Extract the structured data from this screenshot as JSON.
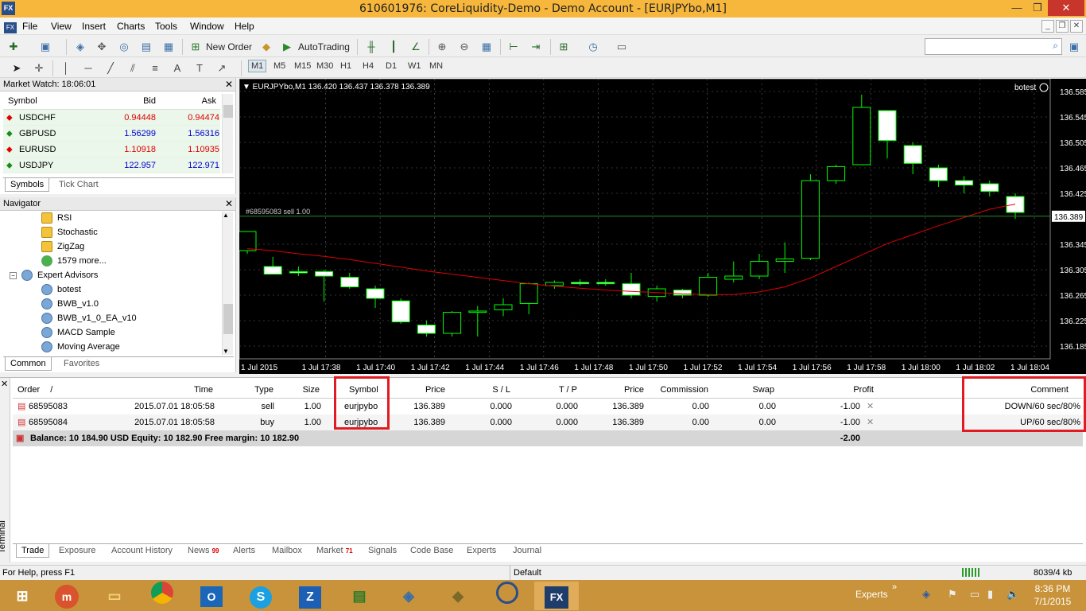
{
  "window": {
    "title": "610601976: CoreLiquidity-Demo - Demo Account - [EURJPYbo,M1]",
    "app_icon": "FX",
    "minimize": "—",
    "maximize": "❐",
    "close": "✕"
  },
  "menu": {
    "items": [
      "File",
      "View",
      "Insert",
      "Charts",
      "Tools",
      "Window",
      "Help"
    ]
  },
  "toolbar": {
    "new_order": "New Order",
    "autotrading": "AutoTrading",
    "timeframes": [
      "M1",
      "M5",
      "M15",
      "M30",
      "H1",
      "H4",
      "D1",
      "W1",
      "MN"
    ],
    "active_timeframe": "M1"
  },
  "market_watch": {
    "title": "Market Watch: 18:06:01",
    "columns": [
      "Symbol",
      "Bid",
      "Ask"
    ],
    "rows": [
      {
        "symbol": "USDCHF",
        "bid": "0.94448",
        "ask": "0.94474",
        "dir": "down"
      },
      {
        "symbol": "GBPUSD",
        "bid": "1.56299",
        "ask": "1.56316",
        "dir": "up"
      },
      {
        "symbol": "EURUSD",
        "bid": "1.10918",
        "ask": "1.10935",
        "dir": "down"
      },
      {
        "symbol": "USDJPY",
        "bid": "122.957",
        "ask": "122.971",
        "dir": "up"
      }
    ],
    "tabs": [
      "Symbols",
      "Tick Chart"
    ]
  },
  "navigator": {
    "title": "Navigator",
    "items": [
      {
        "label": "RSI",
        "kind": "indicator"
      },
      {
        "label": "Stochastic",
        "kind": "indicator"
      },
      {
        "label": "ZigZag",
        "kind": "indicator"
      },
      {
        "label": "1579 more...",
        "kind": "more"
      },
      {
        "label": "Expert Advisors",
        "kind": "folder"
      },
      {
        "label": "botest",
        "kind": "ea"
      },
      {
        "label": "BWB_v1.0",
        "kind": "ea"
      },
      {
        "label": "BWB_v1_0_EA_v10",
        "kind": "ea"
      },
      {
        "label": "MACD Sample",
        "kind": "ea"
      },
      {
        "label": "Moving Average",
        "kind": "ea"
      }
    ],
    "tabs": [
      "Common",
      "Favorites"
    ]
  },
  "chart": {
    "header": "EURJPYbo,M1  136.420 136.437 136.378 136.389",
    "ea_label": "botest",
    "order_label": "#68595083 sell 1.00",
    "current_price": "136.389",
    "y_ticks": [
      "136.585",
      "136.545",
      "136.505",
      "136.465",
      "136.425",
      "136.345",
      "136.305",
      "136.265",
      "136.225",
      "136.185"
    ],
    "x_ticks": [
      "1 Jul 2015",
      "1 Jul 17:38",
      "1 Jul 17:40",
      "1 Jul 17:42",
      "1 Jul 17:44",
      "1 Jul 17:46",
      "1 Jul 17:48",
      "1 Jul 17:50",
      "1 Jul 17:52",
      "1 Jul 17:54",
      "1 Jul 17:56",
      "1 Jul 17:58",
      "1 Jul 18:00",
      "1 Jul 18:02",
      "1 Jul 18:04"
    ],
    "ylim": [
      136.165,
      136.605
    ],
    "candles": [
      {
        "o": 136.335,
        "h": 136.36,
        "l": 136.33,
        "c": 136.365
      },
      {
        "o": 136.31,
        "h": 136.325,
        "l": 136.3,
        "c": 136.298
      },
      {
        "o": 136.302,
        "h": 136.31,
        "l": 136.295,
        "c": 136.3
      },
      {
        "o": 136.302,
        "h": 136.305,
        "l": 136.255,
        "c": 136.295
      },
      {
        "o": 136.293,
        "h": 136.3,
        "l": 136.275,
        "c": 136.278
      },
      {
        "o": 136.275,
        "h": 136.28,
        "l": 136.245,
        "c": 136.26
      },
      {
        "o": 136.256,
        "h": 136.26,
        "l": 136.22,
        "c": 136.223
      },
      {
        "o": 136.218,
        "h": 136.225,
        "l": 136.2,
        "c": 136.205
      },
      {
        "o": 136.205,
        "h": 136.24,
        "l": 136.2,
        "c": 136.238
      },
      {
        "o": 136.238,
        "h": 136.248,
        "l": 136.2,
        "c": 136.24
      },
      {
        "o": 136.242,
        "h": 136.26,
        "l": 136.232,
        "c": 136.25
      },
      {
        "o": 136.252,
        "h": 136.285,
        "l": 136.235,
        "c": 136.283
      },
      {
        "o": 136.28,
        "h": 136.288,
        "l": 136.275,
        "c": 136.285
      },
      {
        "o": 136.285,
        "h": 136.29,
        "l": 136.28,
        "c": 136.283
      },
      {
        "o": 136.285,
        "h": 136.29,
        "l": 136.28,
        "c": 136.283
      },
      {
        "o": 136.283,
        "h": 136.3,
        "l": 136.26,
        "c": 136.265
      },
      {
        "o": 136.263,
        "h": 136.28,
        "l": 136.255,
        "c": 136.275
      },
      {
        "o": 136.273,
        "h": 136.275,
        "l": 136.26,
        "c": 136.265
      },
      {
        "o": 136.265,
        "h": 136.3,
        "l": 136.262,
        "c": 136.293
      },
      {
        "o": 136.29,
        "h": 136.318,
        "l": 136.285,
        "c": 136.295
      },
      {
        "o": 136.295,
        "h": 136.33,
        "l": 136.29,
        "c": 136.318
      },
      {
        "o": 136.318,
        "h": 136.348,
        "l": 136.3,
        "c": 136.322
      },
      {
        "o": 136.323,
        "h": 136.455,
        "l": 136.32,
        "c": 136.445
      },
      {
        "o": 136.445,
        "h": 136.47,
        "l": 136.44,
        "c": 136.467
      },
      {
        "o": 136.47,
        "h": 136.58,
        "l": 136.47,
        "c": 136.56
      },
      {
        "o": 136.555,
        "h": 136.555,
        "l": 136.48,
        "c": 136.508
      },
      {
        "o": 136.5,
        "h": 136.505,
        "l": 136.455,
        "c": 136.472
      },
      {
        "o": 136.465,
        "h": 136.47,
        "l": 136.435,
        "c": 136.445
      },
      {
        "o": 136.445,
        "h": 136.452,
        "l": 136.425,
        "c": 136.438
      },
      {
        "o": 136.44,
        "h": 136.445,
        "l": 136.42,
        "c": 136.428
      },
      {
        "o": 136.42,
        "h": 136.425,
        "l": 136.385,
        "c": 136.395
      }
    ],
    "ma": [
      136.338,
      136.335,
      136.33,
      136.326,
      136.321,
      136.315,
      136.309,
      136.303,
      136.298,
      136.293,
      136.288,
      136.283,
      136.279,
      136.276,
      136.273,
      136.271,
      136.269,
      136.267,
      136.266,
      136.266,
      136.27,
      136.278,
      136.292,
      136.31,
      136.328,
      136.346,
      136.36,
      136.374,
      136.387,
      136.4,
      136.408
    ]
  },
  "terminal": {
    "side_label": "Terminal",
    "columns": [
      "Order",
      "Time",
      "Type",
      "Size",
      "Symbol",
      "Price",
      "S / L",
      "T / P",
      "Price",
      "Commission",
      "Swap",
      "Profit",
      "Comment"
    ],
    "sort_mark": "/",
    "rows": [
      {
        "order": "68595083",
        "time": "2015.07.01 18:05:58",
        "type": "sell",
        "size": "1.00",
        "symbol": "eurjpybo",
        "price": "136.389",
        "sl": "0.000",
        "tp": "0.000",
        "cur": "136.389",
        "commission": "0.00",
        "swap": "0.00",
        "profit": "-1.00",
        "comment": "DOWN/60 sec/80%"
      },
      {
        "order": "68595084",
        "time": "2015.07.01 18:05:58",
        "type": "buy",
        "size": "1.00",
        "symbol": "eurjpybo",
        "price": "136.389",
        "sl": "0.000",
        "tp": "0.000",
        "cur": "136.389",
        "commission": "0.00",
        "swap": "0.00",
        "profit": "-1.00",
        "comment": "UP/60 sec/80%"
      }
    ],
    "balance_line": "Balance: 10 184.90 USD  Equity: 10 182.90  Free margin: 10 182.90",
    "total_profit": "-2.00",
    "tabs": [
      {
        "label": "Trade",
        "badge": ""
      },
      {
        "label": "Exposure",
        "badge": ""
      },
      {
        "label": "Account History",
        "badge": ""
      },
      {
        "label": "News",
        "badge": "99"
      },
      {
        "label": "Alerts",
        "badge": ""
      },
      {
        "label": "Mailbox",
        "badge": ""
      },
      {
        "label": "Market",
        "badge": "71"
      },
      {
        "label": "Signals",
        "badge": ""
      },
      {
        "label": "Code Base",
        "badge": ""
      },
      {
        "label": "Experts",
        "badge": ""
      },
      {
        "label": "Journal",
        "badge": ""
      }
    ]
  },
  "status": {
    "help": "For Help, press F1",
    "profile": "Default",
    "traffic": "8039/4 kb"
  },
  "taskbar": {
    "experts": "Experts",
    "time": "8:36 PM",
    "date": "7/1/2015",
    "fx": "FX"
  }
}
